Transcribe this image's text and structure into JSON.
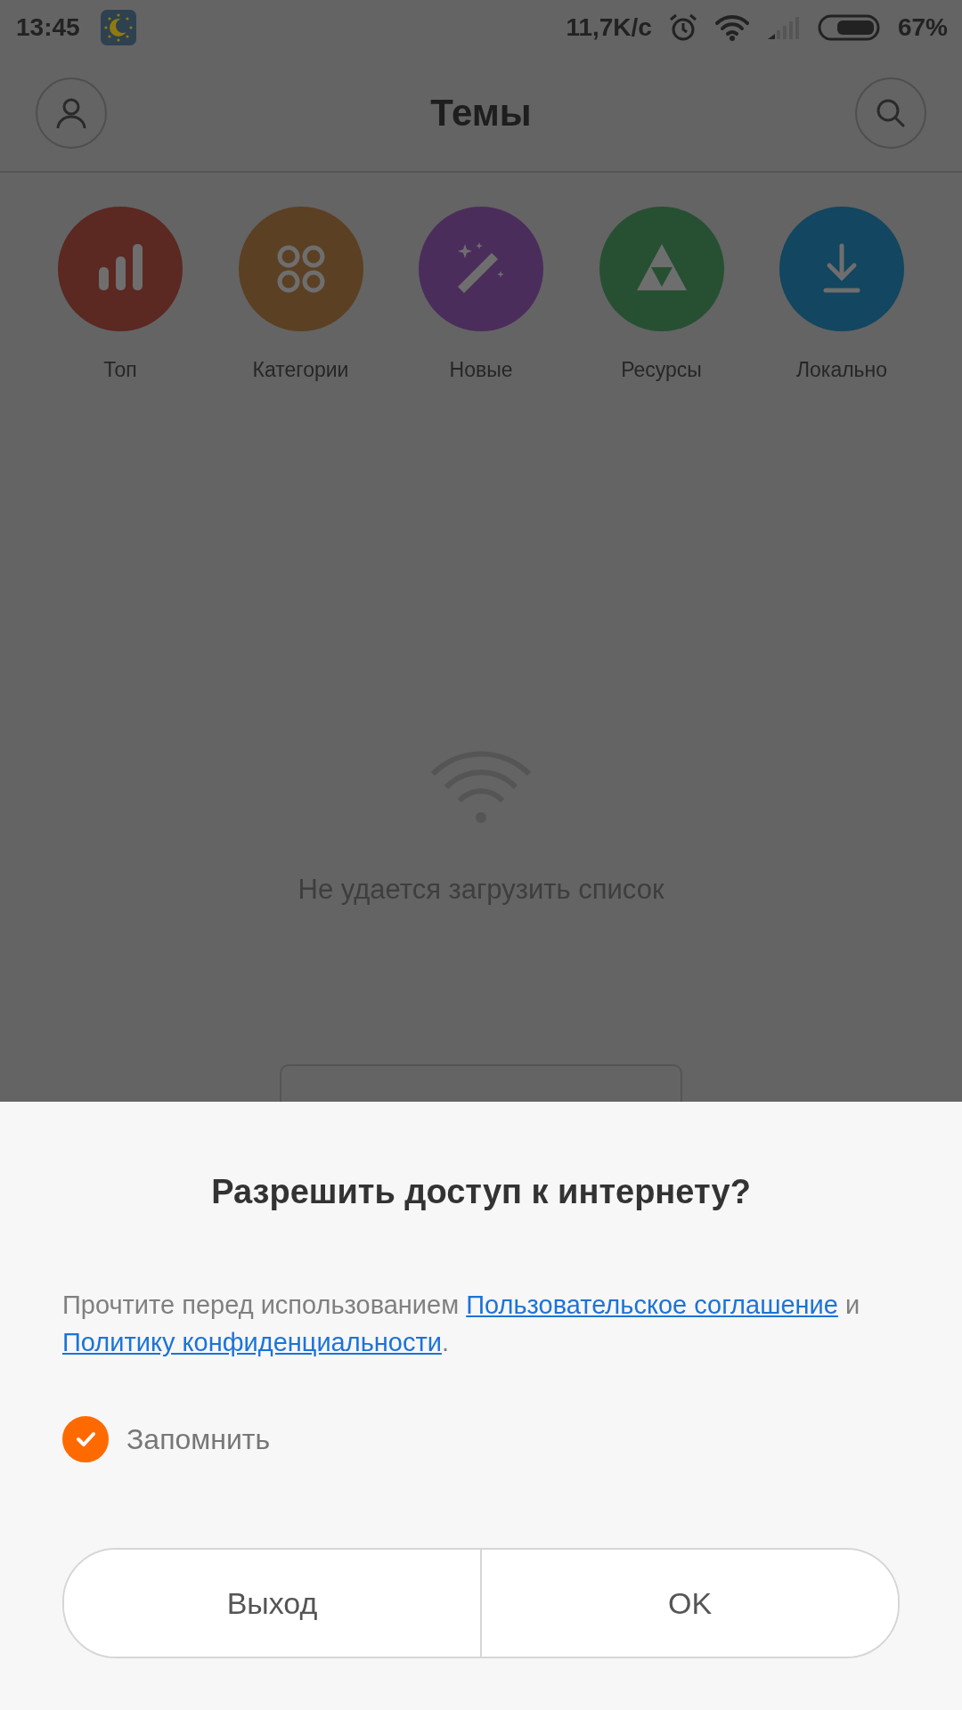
{
  "status_bar": {
    "time": "13:45",
    "network_speed": "11,7K/с",
    "battery": "67%"
  },
  "header": {
    "title": "Темы"
  },
  "categories": [
    {
      "label": "Топ",
      "kind": "top",
      "color": "#5c2822"
    },
    {
      "label": "Категории",
      "kind": "categories",
      "color": "#5c4023"
    },
    {
      "label": "Новые",
      "kind": "new",
      "color": "#4b2d5c"
    },
    {
      "label": "Ресурсы",
      "kind": "resources",
      "color": "#275033"
    },
    {
      "label": "Локально",
      "kind": "local",
      "color": "#134660"
    }
  ],
  "empty_state": {
    "message": "Не удается загрузить список"
  },
  "dialog": {
    "title": "Разрешить доступ к интернету?",
    "body": [
      {
        "kind": "text",
        "text": "Прочтите перед использованием "
      },
      {
        "kind": "link",
        "text": "Пользовательское соглашение"
      },
      {
        "kind": "text",
        "text": " и "
      },
      {
        "kind": "link",
        "text": "Политику конфиденциальности"
      },
      {
        "kind": "text",
        "text": "."
      }
    ],
    "remember": {
      "label": "Запомнить",
      "checked": true
    },
    "buttons": [
      {
        "label": "Выход"
      },
      {
        "label": "OK"
      }
    ]
  }
}
